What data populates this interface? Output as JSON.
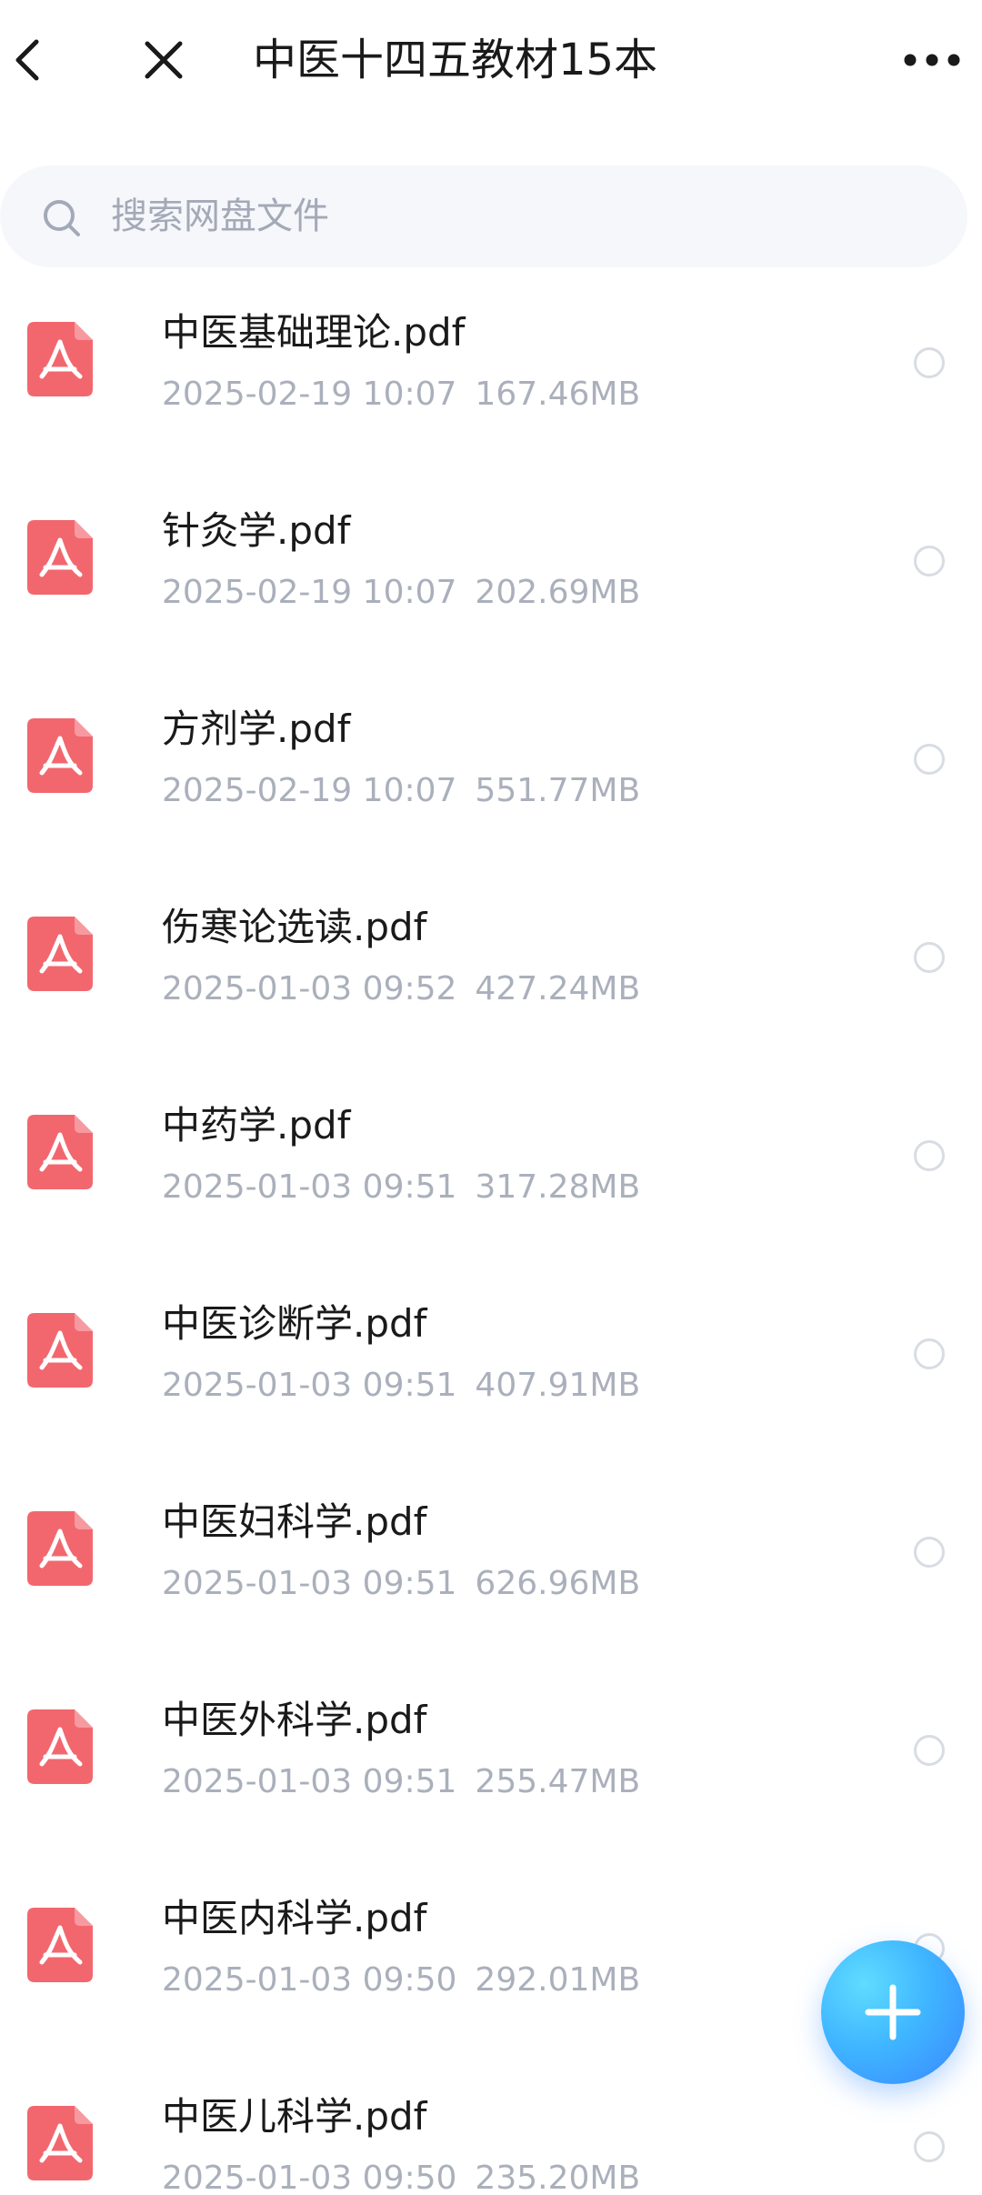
{
  "header": {
    "title": "中医十四五教材15本"
  },
  "search": {
    "placeholder": "搜索网盘文件"
  },
  "files": [
    {
      "name": "中医基础理论.pdf",
      "date": "2025-02-19",
      "time": "10:07",
      "size": "167.46MB"
    },
    {
      "name": "针灸学.pdf",
      "date": "2025-02-19",
      "time": "10:07",
      "size": "202.69MB"
    },
    {
      "name": "方剂学.pdf",
      "date": "2025-02-19",
      "time": "10:07",
      "size": "551.77MB"
    },
    {
      "name": "伤寒论选读.pdf",
      "date": "2025-01-03",
      "time": "09:52",
      "size": "427.24MB"
    },
    {
      "name": "中药学.pdf",
      "date": "2025-01-03",
      "time": "09:51",
      "size": "317.28MB"
    },
    {
      "name": "中医诊断学.pdf",
      "date": "2025-01-03",
      "time": "09:51",
      "size": "407.91MB"
    },
    {
      "name": "中医妇科学.pdf",
      "date": "2025-01-03",
      "time": "09:51",
      "size": "626.96MB"
    },
    {
      "name": "中医外科学.pdf",
      "date": "2025-01-03",
      "time": "09:51",
      "size": "255.47MB"
    },
    {
      "name": "中医内科学.pdf",
      "date": "2025-01-03",
      "time": "09:50",
      "size": "292.01MB"
    },
    {
      "name": "中医儿科学.pdf",
      "date": "2025-01-03",
      "time": "09:50",
      "size": "235.20MB"
    }
  ],
  "icons": {
    "back": "chevron-left-icon",
    "close": "close-icon",
    "more": "more-horizontal-icon",
    "search": "search-icon",
    "file": "pdf-file-icon",
    "fab": "plus-icon"
  },
  "colors": {
    "pdf_red": "#f2676e",
    "fab_blue": "#3fb6ff",
    "meta_gray": "#aab0bb"
  }
}
